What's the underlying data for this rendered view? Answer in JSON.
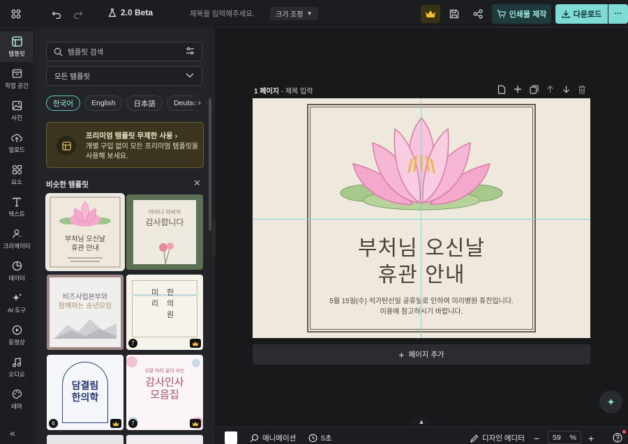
{
  "topbar": {
    "version": "2.0 Beta",
    "title_placeholder": "제목을 입력해주세요.",
    "resize_label": "크기 조정",
    "print_label": "인쇄물 제작",
    "download_label": "다운로드",
    "more_label": "···"
  },
  "nav": [
    {
      "label": "템플릿",
      "icon": "template-icon"
    },
    {
      "label": "작업 공간",
      "icon": "workspace-icon"
    },
    {
      "label": "사진",
      "icon": "photo-icon"
    },
    {
      "label": "업로드",
      "icon": "upload-icon"
    },
    {
      "label": "요소",
      "icon": "elements-icon"
    },
    {
      "label": "텍스트",
      "icon": "text-icon"
    },
    {
      "label": "크리에이터",
      "icon": "creator-icon"
    },
    {
      "label": "데이터",
      "icon": "data-icon"
    },
    {
      "label": "AI 도구",
      "icon": "ai-tools-icon"
    },
    {
      "label": "동영상",
      "icon": "video-icon"
    },
    {
      "label": "오디오",
      "icon": "audio-icon"
    },
    {
      "label": "테마",
      "icon": "theme-icon"
    }
  ],
  "panel": {
    "search_placeholder": "템플릿 검색",
    "filter_value": "모든 템플릿",
    "languages": [
      "한국어",
      "English",
      "日本語",
      "Deutsch"
    ],
    "promo_title": "프리미엄 템플릿 무제한 사용",
    "promo_desc": "개별 구입 없이 모든 프리미엄 템플릿을 사용해 보세요.",
    "section_title": "비슷한 템플릿",
    "thumbs": [
      {
        "title1": "부처님 오신날",
        "title2": "휴관 안내"
      },
      {
        "title1": "어머니 아버지",
        "title2": "감사합니다"
      },
      {
        "title1": "비즈사업본부와",
        "title2": "함께하는 송년모임"
      },
      {
        "col1": "미리",
        "col2": "한의원",
        "badge": "7"
      },
      {
        "title1": "담결림",
        "title2": "한의학",
        "badge": "6"
      },
      {
        "title0": "상황 따라 골라 쓰는",
        "title1": "감사인사",
        "title2": "모음집",
        "badge": "7"
      }
    ]
  },
  "canvas": {
    "page_number": "1 페이지",
    "page_title_placeholder": "제목 입력",
    "heading_line1": "부처님 오신날",
    "heading_line2": "휴관 안내",
    "body_line1": "5월 15일(수) 석가탄신일 공휴일로 인하여 미리병원 휴진입니다.",
    "body_line2": "이용에 참고하시기 바랍니다.",
    "add_page_label": "페이지 추가"
  },
  "bottombar": {
    "animation_label": "애니메이션",
    "duration_label": "5초",
    "design_editor_label": "디자인 에디터",
    "zoom_value": "59",
    "zoom_unit": "%"
  },
  "colors": {
    "accent": "#7edcd6",
    "page_bg": "#efe8dc",
    "lotus_pink": "#f4a8cc"
  }
}
